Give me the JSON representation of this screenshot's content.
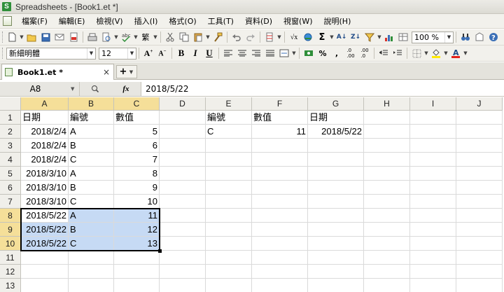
{
  "window": {
    "title": "Spreadsheets - [Book1.et *]",
    "logo_text": "S"
  },
  "menu": [
    "檔案(F)",
    "編輯(E)",
    "檢視(V)",
    "插入(I)",
    "格式(O)",
    "工具(T)",
    "資料(D)",
    "視窗(W)",
    "說明(H)"
  ],
  "toolbar1": {
    "zoom": "100 %"
  },
  "toolbar2": {
    "font_name": "新細明體",
    "font_size": "12"
  },
  "tab": {
    "label": "Book1.et *",
    "close": "×",
    "add": "+"
  },
  "formula_bar": {
    "name_box": "A8",
    "formula": "2018/5/22",
    "fx_label": "fx"
  },
  "sheet": {
    "columns": [
      "A",
      "B",
      "C",
      "D",
      "E",
      "F",
      "G",
      "H",
      "I",
      "J"
    ],
    "rows": [
      "1",
      "2",
      "3",
      "4",
      "5",
      "6",
      "7",
      "8",
      "9",
      "10",
      "11",
      "12",
      "13"
    ],
    "selected_columns": [
      "A",
      "B",
      "C"
    ],
    "selected_rows": [
      "8",
      "9",
      "10"
    ],
    "selection_color": "#c6daf4",
    "cells": {
      "A1": "日期",
      "B1": "編號",
      "C1": "數值",
      "A2": "2018/2/4",
      "B2": "A",
      "C2": "5",
      "A3": "2018/2/4",
      "B3": "B",
      "C3": "6",
      "A4": "2018/2/4",
      "B4": "C",
      "C4": "7",
      "A5": "2018/3/10",
      "B5": "A",
      "C5": "8",
      "A6": "2018/3/10",
      "B6": "B",
      "C6": "9",
      "A7": "2018/3/10",
      "B7": "C",
      "C7": "10",
      "A8": "2018/5/22",
      "B8": "A",
      "C8": "11",
      "A9": "2018/5/22",
      "B9": "B",
      "C9": "12",
      "A10": "2018/5/22",
      "B10": "C",
      "C10": "13",
      "E1": "編號",
      "F1": "數值",
      "G1": "日期",
      "E2": "C",
      "F2": "11",
      "G2": "2018/5/22"
    }
  }
}
